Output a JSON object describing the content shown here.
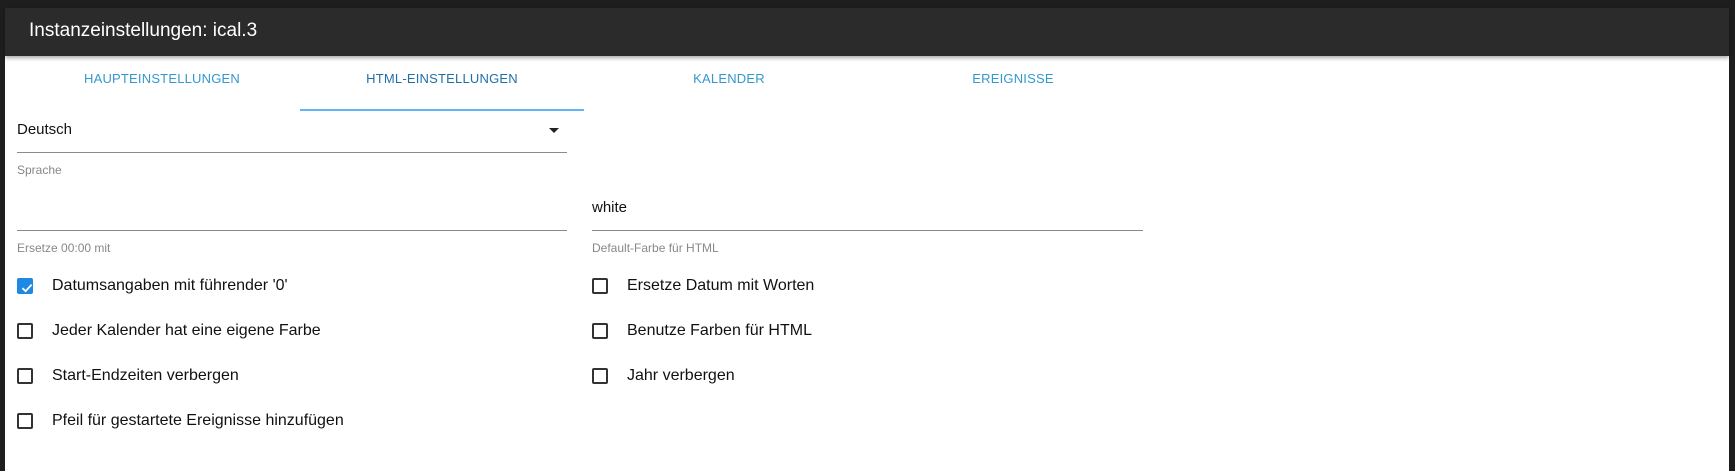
{
  "window": {
    "title": "Instanzeinstellungen: ical.3"
  },
  "tabs": [
    {
      "label": "HAUPTEINSTELLUNGEN",
      "active": false
    },
    {
      "label": "HTML-EINSTELLUNGEN",
      "active": true
    },
    {
      "label": "KALENDER",
      "active": false
    },
    {
      "label": "EREIGNISSE",
      "active": false
    }
  ],
  "language_select": {
    "value": "Deutsch",
    "helper": "Sprache"
  },
  "replace_midnight": {
    "value": "",
    "helper": "Ersetze 00:00 mit"
  },
  "default_color": {
    "value": "white",
    "helper": "Default-Farbe für HTML"
  },
  "checkboxes_left": [
    {
      "label": "Datumsangaben mit führender '0'",
      "checked": true
    },
    {
      "label": "Jeder Kalender hat eine eigene Farbe",
      "checked": false
    },
    {
      "label": "Start-Endzeiten verbergen",
      "checked": false
    },
    {
      "label": "Pfeil für gestartete Ereignisse hinzufügen",
      "checked": false
    }
  ],
  "checkboxes_right": [
    {
      "label": "Ersetze Datum mit Worten",
      "checked": false
    },
    {
      "label": "Benutze Farben für HTML",
      "checked": false
    },
    {
      "label": "Jahr verbergen",
      "checked": false
    }
  ],
  "colors": {
    "accent": "#1e88e5",
    "tab_text": "#3399cc",
    "titlebar": "#2b2b2b"
  }
}
